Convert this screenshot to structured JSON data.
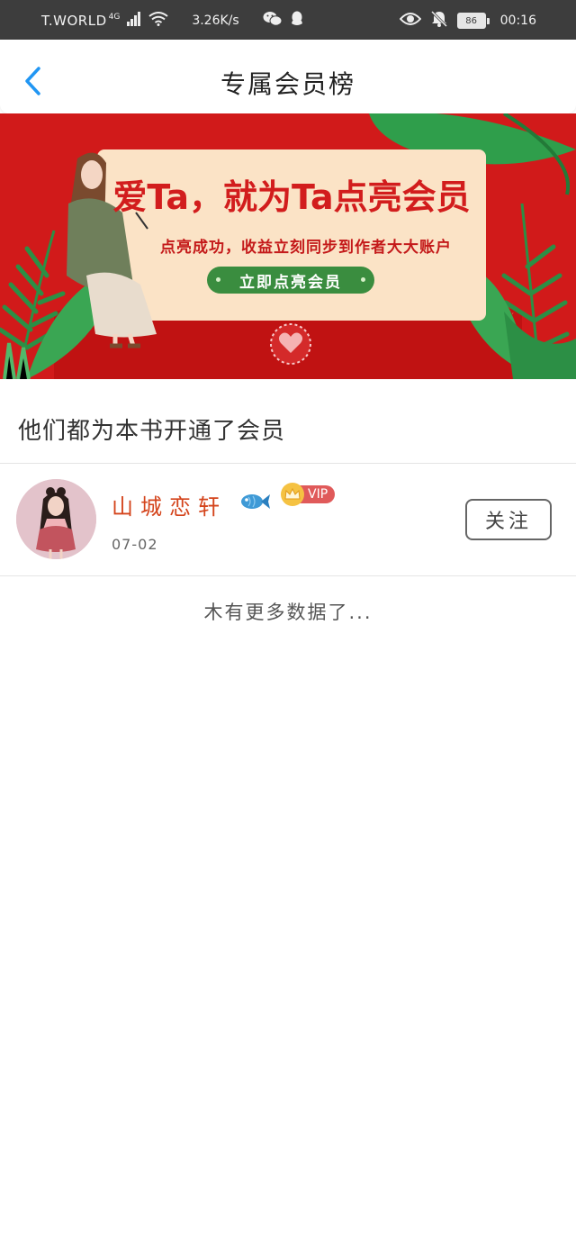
{
  "status_bar": {
    "carrier": "T.WORLD",
    "network": "4G",
    "speed": "3.26K/s",
    "battery": "86",
    "time": "00:16"
  },
  "header": {
    "title": "专属会员榜"
  },
  "banner": {
    "title": "爱Ta，就为Ta点亮会员",
    "subtitle": "点亮成功，收益立刻同步到作者大大账户",
    "cta": "立即点亮会员"
  },
  "section": {
    "heading": "他们都为本书开通了会员"
  },
  "members": [
    {
      "name": "山城恋轩",
      "badge": "VIP",
      "date": "07-02",
      "follow_label": "关注"
    }
  ],
  "footer": {
    "no_more": "木有更多数据了..."
  },
  "colors": {
    "status_bar": "#3d3d3d",
    "back_icon": "#2196f3",
    "banner_red": "#d11a1a",
    "name_red": "#d4441c",
    "vip_red": "#e05a5a",
    "cta_green": "#3a8d3f"
  },
  "icons": [
    "signal-icon",
    "wifi-icon",
    "wechat-icon",
    "qq-icon",
    "eye-icon",
    "bell-off-icon",
    "back-icon",
    "fish-icon",
    "crown-icon"
  ]
}
